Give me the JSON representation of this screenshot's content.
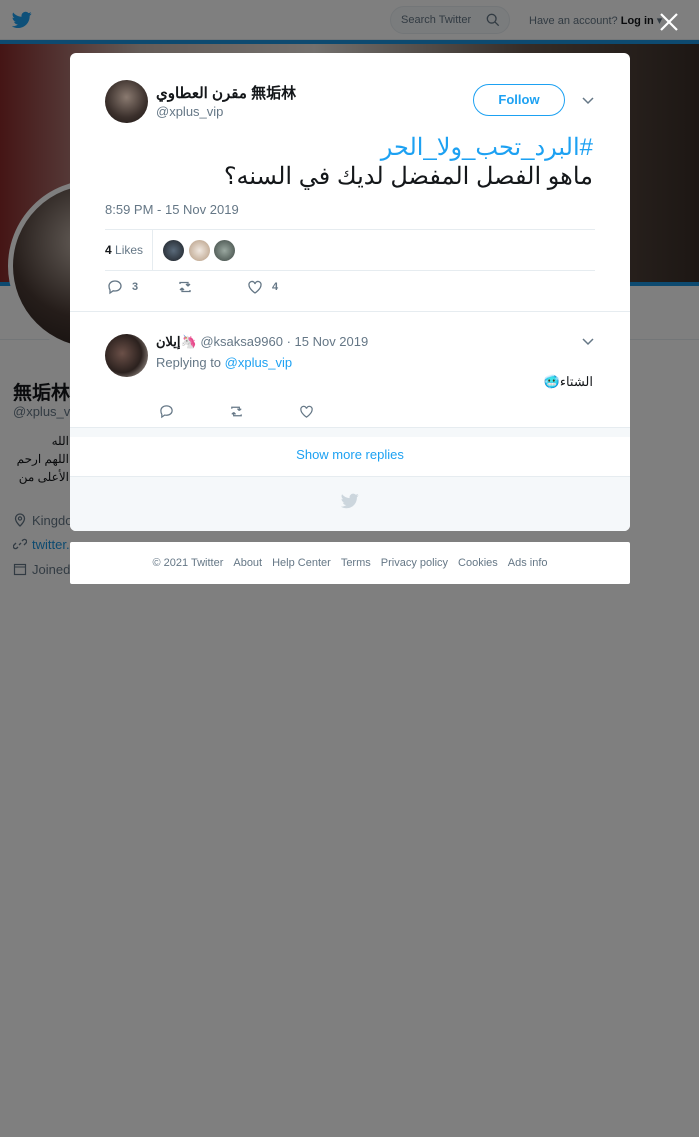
{
  "topbar": {
    "search_placeholder": "Search Twitter",
    "account_prompt": "Have an account?",
    "login_label": "Log in"
  },
  "background_profile": {
    "name": "無垢林",
    "handle": "@xplus_vi",
    "bio_lines": [
      "الله",
      "اللهم ارحم",
      "الأعلى من"
    ],
    "location": "Kingdo",
    "link": "twitter.",
    "joined": "Joined"
  },
  "tweet": {
    "author_name": "مقرن العطاوي 無垢林",
    "author_handle": "@xplus_vip",
    "follow_label": "Follow",
    "hashtag": "#البرد_تحب_ولا_الحر",
    "text": "ماهو الفصل المفضل لديك في السنه؟",
    "timestamp": "8:59 PM - 15 Nov 2019",
    "likes_number": "4",
    "likes_label": "Likes",
    "reply_count": "3",
    "retweet_count": "",
    "like_count": "4"
  },
  "reply": {
    "name": "إيلان🦄",
    "handle": "@ksaksa9960",
    "date": "· 15 Nov 2019",
    "replying_prefix": "Replying to",
    "replying_to": "@xplus_vip",
    "text": "الشتاء🥶"
  },
  "show_more_label": "Show more replies",
  "footer_links": [
    "© 2021 Twitter",
    "About",
    "Help Center",
    "Terms",
    "Privacy policy",
    "Cookies",
    "Ads info"
  ],
  "colors": {
    "accent": "#1da1f2",
    "overlay": "rgba(0,0,0,0.5)",
    "secondary_text": "#657786"
  }
}
